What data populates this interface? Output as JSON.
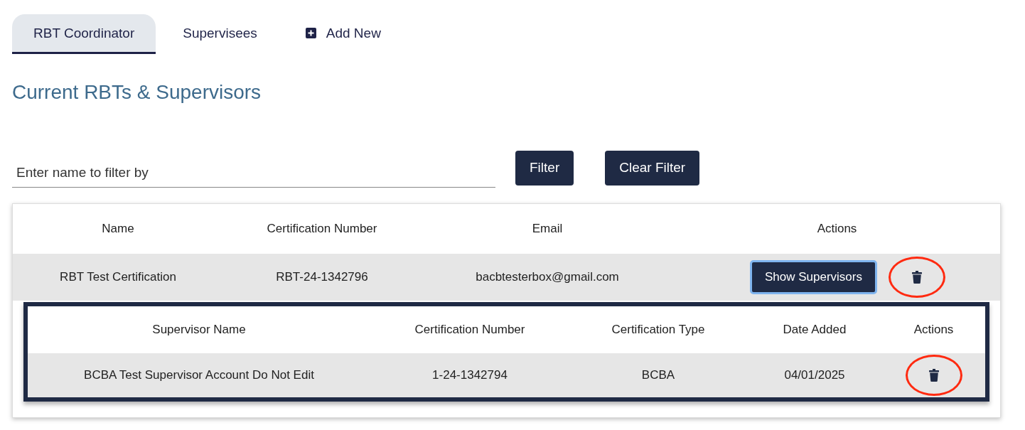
{
  "tabs": [
    {
      "label": "RBT Coordinator",
      "selected": true,
      "kind": "tab"
    },
    {
      "label": "Supervisees",
      "selected": false,
      "kind": "tab"
    },
    {
      "label": "Add New",
      "selected": false,
      "kind": "add"
    }
  ],
  "heading": "Current RBTs & Supervisors",
  "filter": {
    "placeholder": "Enter name to filter by",
    "buttons": [
      "Filter",
      "Clear Filter"
    ]
  },
  "table": {
    "columns": [
      "Name",
      "Certification Number",
      "Email",
      "Actions"
    ],
    "rows": [
      {
        "cells": [
          "RBT Test Certification",
          "RBT-24-1342796",
          "bacbtesterbox@gmail.com"
        ],
        "action": "Show Supervisors",
        "expanded": true,
        "delete_circled": true,
        "subtable": {
          "columns": [
            "Supervisor Name",
            "Certification Number",
            "Certification Type",
            "Date Added",
            "Actions"
          ],
          "rows": [
            {
              "cells": [
                "BCBA Test Supervisor Account Do Not Edit",
                "1-24-1342794",
                "BCBA",
                "04/01/2025"
              ],
              "delete_circled": true
            }
          ]
        }
      }
    ]
  }
}
